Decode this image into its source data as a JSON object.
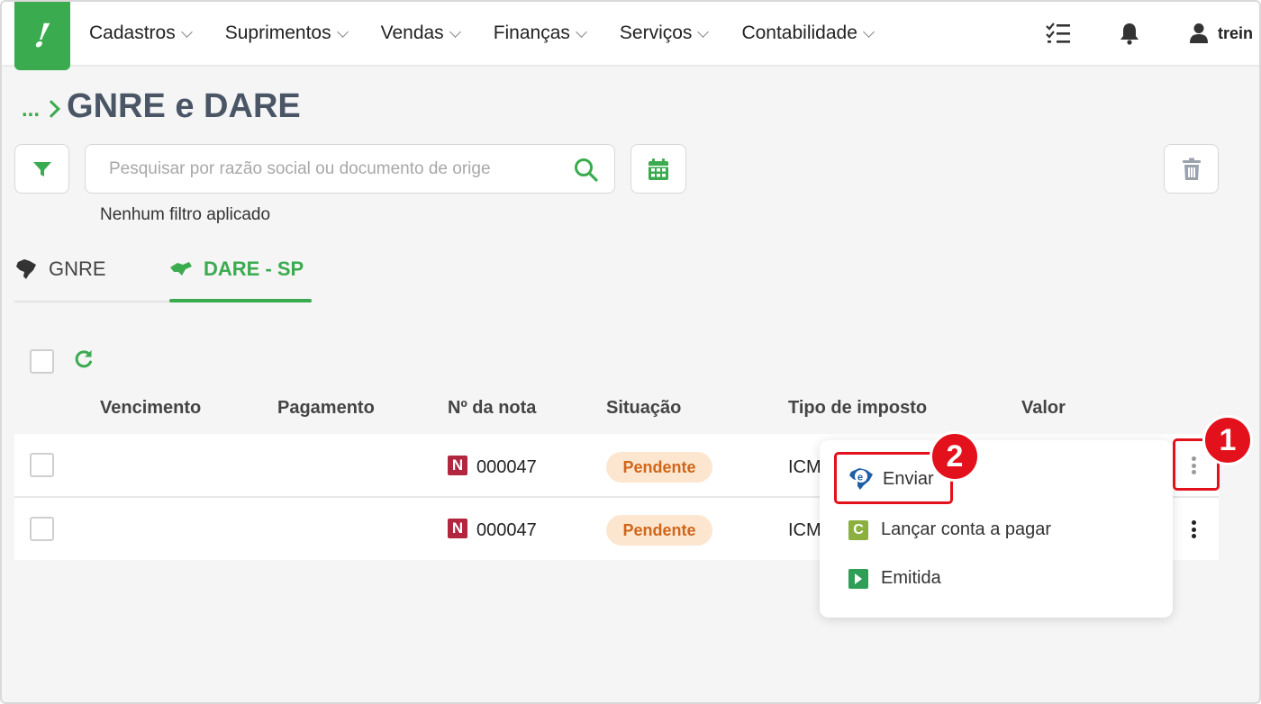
{
  "app": {
    "logo_text": "!",
    "menu": [
      {
        "label": "Cadastros"
      },
      {
        "label": "Suprimentos"
      },
      {
        "label": "Vendas"
      },
      {
        "label": "Finanças"
      },
      {
        "label": "Serviços"
      },
      {
        "label": "Contabilidade"
      }
    ],
    "user_name": "trein",
    "accent_color": "#3bab4f"
  },
  "breadcrumb": {
    "ellipsis": "...",
    "title": "GNRE e DARE"
  },
  "search": {
    "placeholder": "Pesquisar por razão social ou documento de orige",
    "value": ""
  },
  "filter_status": "Nenhum filtro aplicado",
  "tabs": [
    {
      "label": "GNRE",
      "icon": "brazil-map-icon",
      "active": false
    },
    {
      "label": "DARE - SP",
      "icon": "sao-paulo-map-icon",
      "active": true
    }
  ],
  "table": {
    "columns": [
      "Vencimento",
      "Pagamento",
      "Nº da nota",
      "Situação",
      "Tipo de imposto",
      "Valor"
    ],
    "rows": [
      {
        "vencimento": "",
        "pagamento": "",
        "nota_badge": "N",
        "nota": "000047",
        "situacao": "Pendente",
        "tipo": "ICM",
        "valor": ""
      },
      {
        "vencimento": "",
        "pagamento": "",
        "nota_badge": "N",
        "nota": "000047",
        "situacao": "Pendente",
        "tipo": "ICM",
        "valor": ""
      }
    ]
  },
  "row_menu": {
    "items": [
      {
        "label": "Enviar",
        "icon": "sefaz-e-icon"
      },
      {
        "label": "Lançar conta a pagar",
        "icon": "c-icon",
        "icon_text": "C"
      },
      {
        "label": "Emitida",
        "icon": "arrow-right-icon"
      }
    ]
  },
  "annotations": {
    "step1": "1",
    "step2": "2",
    "color": "#e3111b"
  }
}
